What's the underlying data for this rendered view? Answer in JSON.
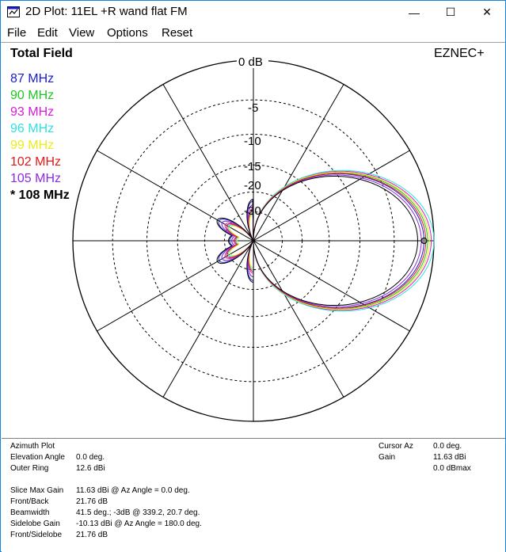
{
  "window": {
    "title": "2D Plot: 11EL +R wand flat FM",
    "controls": {
      "minimize": "—",
      "maximize": "☐",
      "close": "✕"
    }
  },
  "menu": [
    "File",
    "Edit",
    "View",
    "Options",
    "Reset"
  ],
  "plot": {
    "field_label": "Total Field",
    "brand": "EZNEC+",
    "ring_labels": [
      "0 dB",
      "-5",
      "-10",
      "-15",
      "-20",
      "-30"
    ],
    "legend": [
      {
        "label": "87 MHz",
        "color": "#1a1ac8"
      },
      {
        "label": "90 MHz",
        "color": "#22c422"
      },
      {
        "label": "93 MHz",
        "color": "#d81bd8"
      },
      {
        "label": "96 MHz",
        "color": "#2ee0e0"
      },
      {
        "label": "99 MHz",
        "color": "#ecec1a"
      },
      {
        "label": "102 MHz",
        "color": "#e01818"
      },
      {
        "label": "105 MHz",
        "color": "#8a2be2"
      },
      {
        "label": "* 108 MHz",
        "color": "#000000"
      }
    ],
    "traces": [
      {
        "color": "#1a1ac8",
        "gain": 0.945,
        "lobe": 0.58,
        "back": 0.22
      },
      {
        "color": "#22c422",
        "gain": 0.965,
        "lobe": 0.57,
        "back": 0.2
      },
      {
        "color": "#d81bd8",
        "gain": 0.985,
        "lobe": 0.56,
        "back": 0.18
      },
      {
        "color": "#2ee0e0",
        "gain": 1.0,
        "lobe": 0.55,
        "back": 0.16
      },
      {
        "color": "#ecec1a",
        "gain": 0.975,
        "lobe": 0.555,
        "back": 0.15
      },
      {
        "color": "#e01818",
        "gain": 0.955,
        "lobe": 0.56,
        "back": 0.17
      },
      {
        "color": "#8a2be2",
        "gain": 0.93,
        "lobe": 0.57,
        "back": 0.2
      },
      {
        "color": "#000000",
        "gain": 0.91,
        "lobe": 0.58,
        "back": 0.23
      }
    ]
  },
  "info": {
    "plot_type": "Azimuth Plot",
    "elevation_angle_label": "Elevation Angle",
    "elevation_angle_value": "0.0 deg.",
    "outer_ring_label": "Outer Ring",
    "outer_ring_value": "12.6 dBi",
    "slice_max_gain_label": "Slice Max Gain",
    "slice_max_gain_value": "11.63 dBi @ Az Angle = 0.0 deg.",
    "front_back_label": "Front/Back",
    "front_back_value": "21.76 dB",
    "beamwidth_label": "Beamwidth",
    "beamwidth_value": "41.5 deg.; -3dB @ 339.2, 20.7 deg.",
    "sidelobe_gain_label": "Sidelobe Gain",
    "sidelobe_gain_value": "-10.13 dBi @ Az Angle = 180.0 deg.",
    "front_sidelobe_label": "Front/Sidelobe",
    "front_sidelobe_value": "21.76 dB",
    "cursor_az_label": "Cursor Az",
    "cursor_az_value": "0.0 deg.",
    "gain_label": "Gain",
    "gain_value": "11.63 dBi",
    "gain_dbmax_value": "0.0 dBmax"
  }
}
